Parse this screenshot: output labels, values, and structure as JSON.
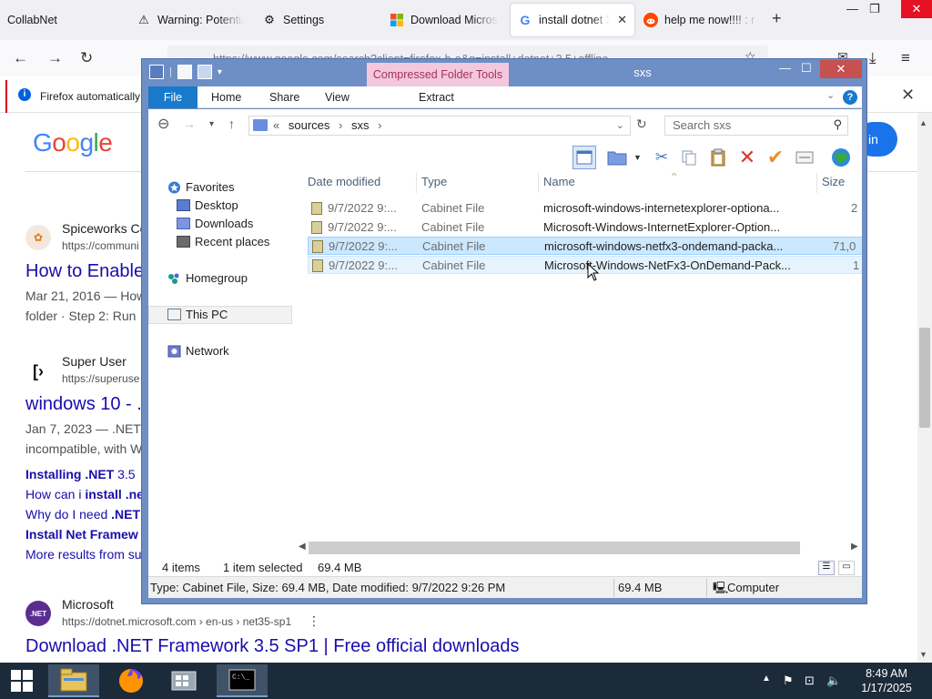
{
  "browser": {
    "tabs": [
      {
        "title": "CollabNet",
        "icon": "blank-icon"
      },
      {
        "title": "Warning: Potentia",
        "icon": "warning-icon"
      },
      {
        "title": "Settings",
        "icon": "gear-icon"
      },
      {
        "title": "Download Microso",
        "icon": "microsoft-logo-icon"
      },
      {
        "title": "install dotnet 3",
        "icon": "google-g-icon",
        "active": true
      },
      {
        "title": "help me now!!!! : r",
        "icon": "reddit-icon"
      }
    ],
    "url": "https://www.google.com/search?client=firefox-b-e&q=install+dotnet+3.5+offline",
    "notification": "Firefox automatically"
  },
  "google": {
    "logo": "Google",
    "signin_label": "in",
    "results": [
      {
        "site_name": "Spiceworks Co",
        "site_url": "https://communi",
        "title": "How to Enable",
        "snippet_lines": [
          "Mar 21, 2016 — How",
          "folder · Step 2: Run"
        ]
      },
      {
        "site_name": "Super User",
        "site_url": "https://superuse",
        "title": "windows 10 - .",
        "snippet_lines": [
          "Jan 7, 2023 — .NET",
          "incompatible, with W"
        ],
        "sublinks": [
          {
            "parts": [
              "Installing ",
              ".NET",
              " 3.5"
            ]
          },
          {
            "parts": [
              "How can i ",
              "install",
              " .ne"
            ]
          },
          {
            "parts": [
              "Why do I need ",
              ".NET",
              ""
            ]
          },
          {
            "parts": [
              "Install Net Framew",
              "",
              ""
            ]
          }
        ],
        "more": "More results from su"
      },
      {
        "site_name": "Microsoft",
        "site_url": "https://dotnet.microsoft.com › en-us › net35-sp1",
        "title": "Download .NET Framework 3.5 SP1 | Free official downloads"
      }
    ]
  },
  "explorer": {
    "title": "sxs",
    "context_tab": "Compressed Folder Tools",
    "ribbon_tabs": [
      "File",
      "Home",
      "Share",
      "View",
      "Extract"
    ],
    "address": {
      "prefix": "«",
      "parts": [
        "sources",
        "sxs"
      ]
    },
    "search_placeholder": "Search sxs",
    "nav": {
      "favorites": "Favorites",
      "desktop": "Desktop",
      "downloads": "Downloads",
      "recent": "Recent places",
      "homegroup": "Homegroup",
      "thispc": "This PC",
      "network": "Network"
    },
    "columns": [
      "Date modified",
      "Type",
      "Name",
      "Size"
    ],
    "files": [
      {
        "date": "9/7/2022 9:...",
        "type": "Cabinet File",
        "name": "microsoft-windows-internetexplorer-optiona...",
        "size": "2",
        "state": "normal"
      },
      {
        "date": "9/7/2022 9:...",
        "type": "Cabinet File",
        "name": "Microsoft-Windows-InternetExplorer-Option...",
        "size": "",
        "state": "normal"
      },
      {
        "date": "9/7/2022 9:...",
        "type": "Cabinet File",
        "name": "microsoft-windows-netfx3-ondemand-packa...",
        "size": "71,0",
        "state": "selected"
      },
      {
        "date": "9/7/2022 9:...",
        "type": "Cabinet File",
        "name": "Microsoft-Windows-NetFx3-OnDemand-Pack...",
        "size": "1",
        "state": "hover"
      }
    ],
    "status": {
      "items": "4 items",
      "selected": "1 item selected",
      "sel_size": "69.4 MB"
    },
    "details": {
      "info": "Type: Cabinet File, Size: 69.4 MB, Date modified: 9/7/2022 9:26 PM",
      "size": "69.4 MB",
      "location": "Computer"
    }
  },
  "taskbar": {
    "time": "8:49 AM",
    "date": "1/17/2025"
  }
}
